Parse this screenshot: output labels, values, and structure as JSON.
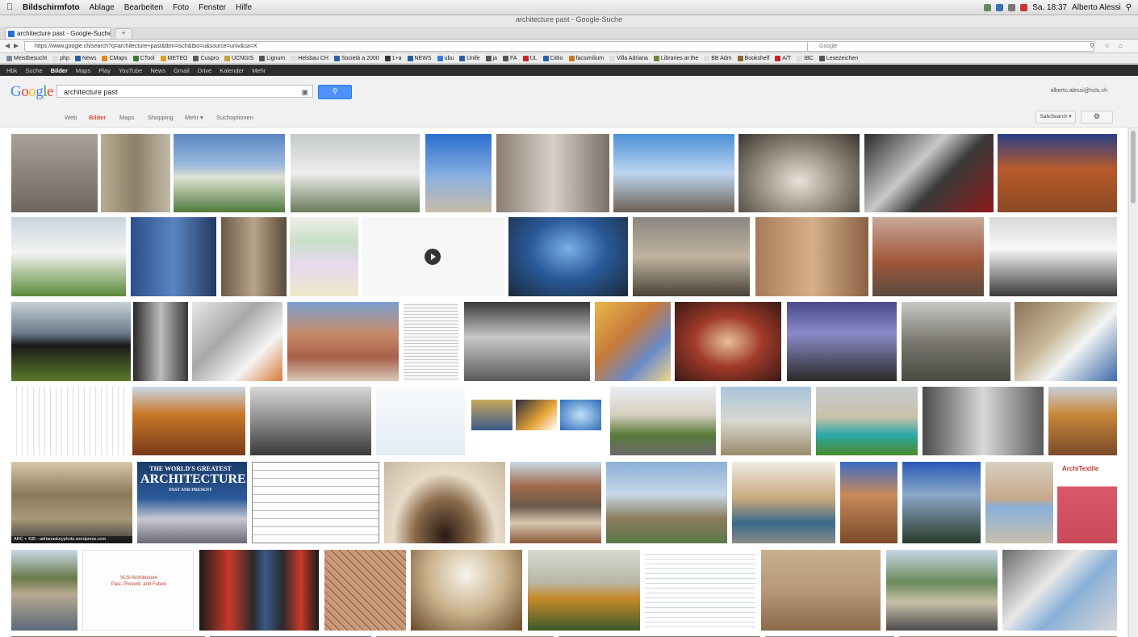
{
  "menubar": {
    "app": "Bildschirmfoto",
    "items": [
      "Ablage",
      "Bearbeiten",
      "Foto",
      "Fenster",
      "Hilfe"
    ],
    "clock": "Sa. 18:37",
    "user": "Alberto Alessi"
  },
  "window": {
    "title": "architecture past - Google-Suche"
  },
  "tabs": [
    {
      "label": "architecture past - Google-Suche"
    }
  ],
  "navbar": {
    "url": "https://www.google.ch/search?q=architecture+past&tbm=isch&tbo=u&source=univ&sa=X",
    "search_placeholder": "Google"
  },
  "bookmarks": [
    "Meistbesucht",
    "php",
    "News",
    "CMaps",
    "CTool",
    "METEO",
    "Cuspro",
    "UCNGIS",
    "Lignum",
    "Helsbau CH",
    "Società a 2000",
    "1+a",
    "NEWS",
    "ubu",
    "Unife",
    "ja",
    "FA",
    "UL",
    "Cittio",
    "facsimilium",
    "Villa Adriana",
    "Libraries at the",
    "BB Adm",
    "Bookshelf",
    "A/T",
    "IBC",
    "Lesezeichen"
  ],
  "google_bar": {
    "items": [
      "Hbk",
      "Suche",
      "Bilder",
      "Maps",
      "Play",
      "YouTube",
      "News",
      "Gmail",
      "Drive",
      "Kalender",
      "Mehr"
    ],
    "active": "Bilder"
  },
  "search": {
    "query": "architecture past",
    "button_icon": "search-icon"
  },
  "account": {
    "email": "alberto.alessi@hslu.ch"
  },
  "subnav": {
    "items": [
      "Web",
      "Bilder",
      "Maps",
      "Shopping",
      "Mehr",
      "Suchoptionen"
    ],
    "active": "Bilder",
    "safesearch": "SafeSearch",
    "settings_icon": "gear-icon"
  },
  "results": {
    "book_title_top": "THE WORLD'S GREATEST",
    "book_title_main": "ARCHITECTURE",
    "book_subtitle": "PAST AND PRESENT",
    "slide_title": "VLSI Architecture",
    "slide_subtitle": "Past, Present, and Future",
    "archi_label": "ArchiTextile",
    "caption": "ARC + 435 - adrianaskeyphoto.wordpress.com"
  }
}
